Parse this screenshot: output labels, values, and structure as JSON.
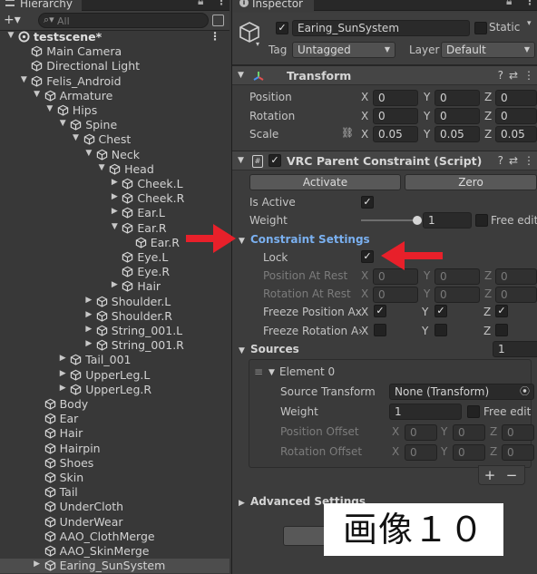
{
  "hierarchy": {
    "tab_title": "Hierarchy",
    "search_placeholder": "All",
    "add_label": "+▾",
    "rows": [
      {
        "label": "testscene*",
        "depth": 0,
        "arrow": "▼",
        "icon": "unity-scene-icon",
        "root": true
      },
      {
        "label": "Main Camera",
        "depth": 1,
        "arrow": "",
        "icon": "gameobject-icon"
      },
      {
        "label": "Directional Light",
        "depth": 1,
        "arrow": "",
        "icon": "gameobject-icon"
      },
      {
        "label": "Felis_Android",
        "depth": 1,
        "arrow": "▼",
        "icon": "gameobject-icon"
      },
      {
        "label": "Armature",
        "depth": 2,
        "arrow": "▼",
        "icon": "gameobject-icon"
      },
      {
        "label": "Hips",
        "depth": 3,
        "arrow": "▼",
        "icon": "gameobject-icon"
      },
      {
        "label": "Spine",
        "depth": 4,
        "arrow": "▼",
        "icon": "gameobject-icon"
      },
      {
        "label": "Chest",
        "depth": 5,
        "arrow": "▼",
        "icon": "gameobject-icon"
      },
      {
        "label": "Neck",
        "depth": 6,
        "arrow": "▼",
        "icon": "gameobject-icon"
      },
      {
        "label": "Head",
        "depth": 7,
        "arrow": "▼",
        "icon": "gameobject-icon"
      },
      {
        "label": "Cheek.L",
        "depth": 8,
        "arrow": "▶",
        "icon": "gameobject-icon"
      },
      {
        "label": "Cheek.R",
        "depth": 8,
        "arrow": "▶",
        "icon": "gameobject-icon"
      },
      {
        "label": "Ear.L",
        "depth": 8,
        "arrow": "▶",
        "icon": "gameobject-icon"
      },
      {
        "label": "Ear.R",
        "depth": 8,
        "arrow": "▼",
        "icon": "gameobject-icon"
      },
      {
        "label": "Ear.R",
        "depth": 9,
        "arrow": "",
        "icon": "gameobject-icon"
      },
      {
        "label": "Eye.L",
        "depth": 8,
        "arrow": "",
        "icon": "gameobject-icon"
      },
      {
        "label": "Eye.R",
        "depth": 8,
        "arrow": "",
        "icon": "gameobject-icon"
      },
      {
        "label": "Hair",
        "depth": 8,
        "arrow": "▶",
        "icon": "gameobject-icon"
      },
      {
        "label": "Shoulder.L",
        "depth": 6,
        "arrow": "▶",
        "icon": "gameobject-icon"
      },
      {
        "label": "Shoulder.R",
        "depth": 6,
        "arrow": "▶",
        "icon": "gameobject-icon"
      },
      {
        "label": "String_001.L",
        "depth": 6,
        "arrow": "▶",
        "icon": "gameobject-icon"
      },
      {
        "label": "String_001.R",
        "depth": 6,
        "arrow": "▶",
        "icon": "gameobject-icon"
      },
      {
        "label": "Tail_001",
        "depth": 4,
        "arrow": "▶",
        "icon": "gameobject-icon"
      },
      {
        "label": "UpperLeg.L",
        "depth": 4,
        "arrow": "▶",
        "icon": "gameobject-icon"
      },
      {
        "label": "UpperLeg.R",
        "depth": 4,
        "arrow": "▶",
        "icon": "gameobject-icon"
      },
      {
        "label": "Body",
        "depth": 2,
        "arrow": "",
        "icon": "gameobject-icon"
      },
      {
        "label": "Ear",
        "depth": 2,
        "arrow": "",
        "icon": "gameobject-icon"
      },
      {
        "label": "Hair",
        "depth": 2,
        "arrow": "",
        "icon": "gameobject-icon"
      },
      {
        "label": "Hairpin",
        "depth": 2,
        "arrow": "",
        "icon": "gameobject-icon"
      },
      {
        "label": "Shoes",
        "depth": 2,
        "arrow": "",
        "icon": "gameobject-icon"
      },
      {
        "label": "Skin",
        "depth": 2,
        "arrow": "",
        "icon": "gameobject-icon"
      },
      {
        "label": "Tail",
        "depth": 2,
        "arrow": "",
        "icon": "gameobject-icon"
      },
      {
        "label": "UnderCloth",
        "depth": 2,
        "arrow": "",
        "icon": "gameobject-icon"
      },
      {
        "label": "UnderWear",
        "depth": 2,
        "arrow": "",
        "icon": "gameobject-icon"
      },
      {
        "label": "AAO_ClothMerge",
        "depth": 2,
        "arrow": "",
        "icon": "gameobject-icon"
      },
      {
        "label": "AAO_SkinMerge",
        "depth": 2,
        "arrow": "",
        "icon": "gameobject-icon"
      },
      {
        "label": "Earing_SunSystem",
        "depth": 2,
        "arrow": "▶",
        "icon": "gameobject-icon",
        "selected": true
      }
    ]
  },
  "inspector": {
    "tab_title": "Inspector",
    "object_name": "Earing_SunSystem",
    "static_label": "Static",
    "tag_label": "Tag",
    "tag_value": "Untagged",
    "layer_label": "Layer",
    "layer_value": "Default",
    "transform": {
      "title": "Transform",
      "position_label": "Position",
      "rotation_label": "Rotation",
      "scale_label": "Scale",
      "position": {
        "x": "0",
        "y": "0",
        "z": "0"
      },
      "rotation": {
        "x": "0",
        "y": "0",
        "z": "0"
      },
      "scale": {
        "x": "0.05",
        "y": "0.05",
        "z": "0.05"
      }
    },
    "constraint": {
      "title": "VRC Parent Constraint (Script)",
      "activate_label": "Activate",
      "zero_label": "Zero",
      "is_active_label": "Is Active",
      "weight_label": "Weight",
      "weight_value": "1",
      "weight_fraction": 1.0,
      "free_edit_label": "Free edit",
      "settings_title": "Constraint Settings",
      "lock_label": "Lock",
      "position_at_rest_label": "Position At Rest",
      "rotation_at_rest_label": "Rotation At Rest",
      "freeze_position_label": "Freeze Position Ax",
      "freeze_rotation_label": "Freeze Rotation A›",
      "rest_position": {
        "x": "0",
        "y": "0",
        "z": "0"
      },
      "rest_rotation": {
        "x": "0",
        "y": "0",
        "z": "0"
      },
      "sources_title": "Sources",
      "sources_count": "1",
      "element_label": "Element 0",
      "source_transform_label": "Source Transform",
      "source_transform_value": "None (Transform)",
      "element_weight_label": "Weight",
      "element_weight_value": "1",
      "element_free_edit_label": "Free edit",
      "position_offset_label": "Position Offset",
      "rotation_offset_label": "Rotation Offset",
      "position_offset": {
        "x": "0",
        "y": "0",
        "z": "0"
      },
      "rotation_offset": {
        "x": "0",
        "y": "0",
        "z": "0"
      },
      "plus_label": "+",
      "minus_label": "−",
      "advanced_title": "Advanced Settings"
    },
    "axis_labels": {
      "x": "X",
      "y": "Y",
      "z": "Z"
    }
  },
  "caption": "画像１０",
  "colors": {
    "panel_bg": "#383838",
    "inspector_bg": "#3c3c3c",
    "selection": "#4d4d4d",
    "settings_blue": "#7ab0f0",
    "annotation_red": "#e8202a"
  }
}
